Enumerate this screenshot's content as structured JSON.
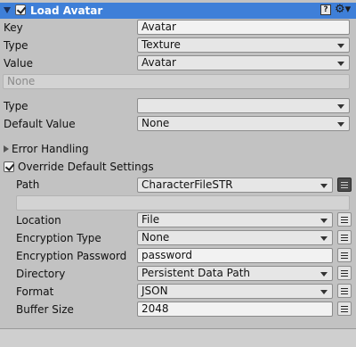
{
  "header": {
    "title": "Load Avatar",
    "enabled": true
  },
  "key": {
    "label": "Key",
    "value": "Avatar"
  },
  "type1": {
    "label": "Type",
    "value": "Texture"
  },
  "value": {
    "label": "Value",
    "value": "Avatar"
  },
  "object_field": {
    "placeholder": "None"
  },
  "type2": {
    "label": "Type",
    "value": ""
  },
  "default_value": {
    "label": "Default Value",
    "value": "None"
  },
  "error_handling": {
    "label": "Error Handling",
    "expanded": false
  },
  "override": {
    "label": "Override Default Settings",
    "checked": true
  },
  "settings": {
    "path": {
      "label": "Path",
      "value": "CharacterFileSTR"
    },
    "location": {
      "label": "Location",
      "value": "File"
    },
    "encryption_type": {
      "label": "Encryption Type",
      "value": "None"
    },
    "encryption_password": {
      "label": "Encryption Password",
      "value": "password"
    },
    "directory": {
      "label": "Directory",
      "value": "Persistent Data Path"
    },
    "format": {
      "label": "Format",
      "value": "JSON"
    },
    "buffer_size": {
      "label": "Buffer Size",
      "value": "2048"
    }
  },
  "icons": {
    "help": "help-icon",
    "gear": "gear-icon",
    "menu": "hamburger-menu-icon"
  },
  "colors": {
    "header_bg": "#3e7fd8",
    "panel_bg": "#c2c2c2"
  }
}
